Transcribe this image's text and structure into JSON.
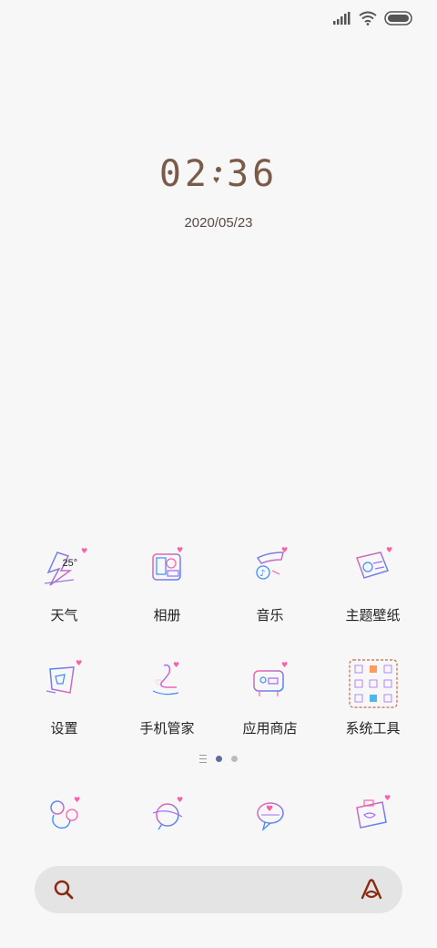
{
  "status_bar": {
    "signal_icon": "signal-icon",
    "wifi_icon": "wifi-icon",
    "battery_icon": "battery-icon"
  },
  "lockclock": {
    "hours": "02",
    "minutes": "36",
    "date": "2020/05/23"
  },
  "apps_row1": [
    {
      "label": "天气",
      "icon": "weather-icon",
      "badge": "25°"
    },
    {
      "label": "相册",
      "icon": "gallery-icon"
    },
    {
      "label": "音乐",
      "icon": "music-icon"
    },
    {
      "label": "主题壁纸",
      "icon": "theme-icon"
    }
  ],
  "apps_row2": [
    {
      "label": "设置",
      "icon": "settings-icon"
    },
    {
      "label": "手机管家",
      "icon": "security-icon"
    },
    {
      "label": "应用商店",
      "icon": "app-store-icon"
    },
    {
      "label": "系统工具",
      "icon": "system-tools-folder-icon"
    }
  ],
  "dock": [
    {
      "icon": "phone-icon"
    },
    {
      "icon": "messages-icon"
    },
    {
      "icon": "chat-icon"
    },
    {
      "icon": "camera-icon"
    }
  ],
  "page_indicator": {
    "pages": 2,
    "current": 1
  },
  "search": {
    "placeholder": ""
  },
  "colors": {
    "clock": "#7a5a49",
    "pink": "#ff5fa8",
    "blue": "#3d8bff",
    "accent_dark": "#8a2a12"
  }
}
